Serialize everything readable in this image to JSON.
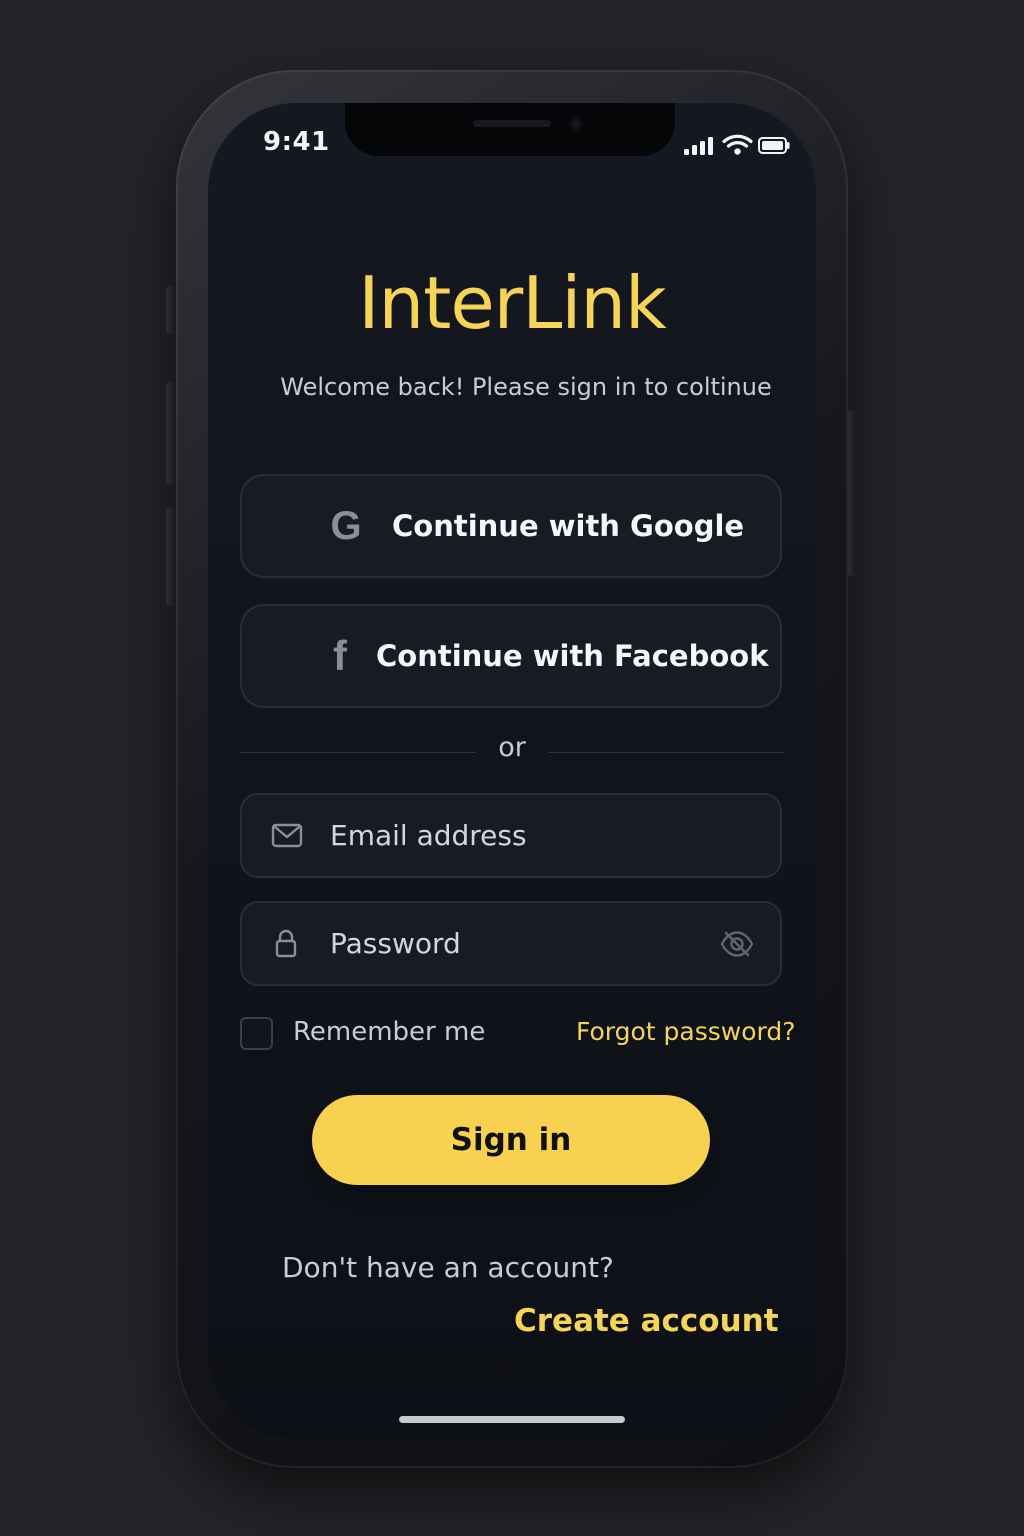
{
  "status_bar": {
    "time": "9:41",
    "signal_icon": "signal-icon",
    "wifi_icon": "wifi-icon",
    "battery_icon": "battery-icon"
  },
  "app": {
    "title": "InterLink",
    "subtitle": "Welcome back! Please sign in to coltinue"
  },
  "social": {
    "google": {
      "icon_glyph": "G",
      "label": "Continue with Google"
    },
    "facebook": {
      "icon_glyph": "f",
      "label": "Continue with Facebook"
    }
  },
  "divider": {
    "label": "or"
  },
  "form": {
    "email": {
      "label": "Email address",
      "icon": "mail-icon"
    },
    "password": {
      "label": "Password",
      "icon": "lock-icon",
      "toggle_icon": "eye-off-icon"
    },
    "remember_me": "Remember me",
    "forgot_password": "Forgot password?",
    "submit": "Sign in"
  },
  "signup": {
    "question": "Don't have an account?",
    "link": "Create account"
  },
  "colors": {
    "background": "#232428",
    "screen": "#11141b",
    "accent": "#f8d150",
    "panel": "#181b24",
    "text": "#f5f6f8",
    "muted_text": "#c9ccd5"
  }
}
